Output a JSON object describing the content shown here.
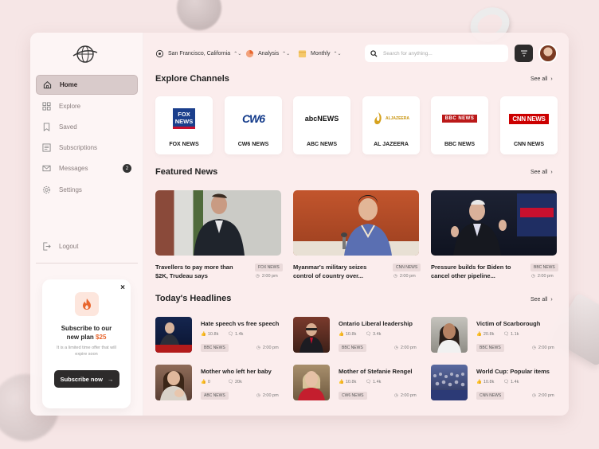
{
  "colors": {
    "accent": "#e8662e",
    "dark": "#2d2b2b",
    "active_nav": "#d9cbcb",
    "panel": "#fbeeee"
  },
  "sidebar": {
    "items": [
      {
        "label": "Home",
        "icon": "home-icon"
      },
      {
        "label": "Explore",
        "icon": "grid-icon"
      },
      {
        "label": "Saved",
        "icon": "bookmark-icon"
      },
      {
        "label": "Subscriptions",
        "icon": "list-icon"
      },
      {
        "label": "Messages",
        "icon": "mail-icon",
        "badge": "2"
      },
      {
        "label": "Settings",
        "icon": "gear-icon"
      }
    ],
    "logout": "Logout"
  },
  "promo": {
    "close": "×",
    "title_pre": "Subscribe to our",
    "title_new": "new plan",
    "price": "$25",
    "note": "It is a limited time offer that will expire soon",
    "button": "Subscribe now"
  },
  "topbar": {
    "location": "San Francisco, California",
    "analysis": "Analysis",
    "period": "Monthly",
    "search_placeholder": "Search for anything..."
  },
  "channels": {
    "title": "Explore Channels",
    "see_all": "See all",
    "items": [
      {
        "name": "FOX NEWS",
        "logo": "FOX NEWS"
      },
      {
        "name": "CW6 NEWS",
        "logo": "CW6"
      },
      {
        "name": "ABC NEWS",
        "logo": "abcNEWS"
      },
      {
        "name": "AL JAZEERA",
        "logo": "ALJAZEERA"
      },
      {
        "name": "BBC NEWS",
        "logo": "BBC NEWS"
      },
      {
        "name": "CNN NEWS",
        "logo": "CNN NEWS"
      }
    ]
  },
  "featured": {
    "title": "Featured News",
    "see_all": "See all",
    "items": [
      {
        "title": "Travellers to pay more than $2K, Trudeau says",
        "tag": "FOX NEWS",
        "time": "2:00 pm"
      },
      {
        "title": "Myanmar's military seizes control of country over...",
        "tag": "CNN NEWS",
        "time": "2:00 pm"
      },
      {
        "title": "Pressure builds for Biden to cancel other pipeline...",
        "tag": "BBC NEWS",
        "time": "2:00 pm"
      }
    ]
  },
  "headlines": {
    "title": "Today's Headlines",
    "see_all": "See all",
    "items": [
      {
        "title": "Hate speech vs free speech",
        "likes": "10.8k",
        "comments": "1.4k",
        "tag": "BBC NEWS",
        "time": "2:00 pm"
      },
      {
        "title": "Ontario Liberal leadership",
        "likes": "10.8k",
        "comments": "3.4k",
        "tag": "BBC NEWS",
        "time": "2:00 pm"
      },
      {
        "title": "Victim of Scarborough",
        "likes": "20.8k",
        "comments": "1.1k",
        "tag": "BBC NEWS",
        "time": "2:00 pm"
      },
      {
        "title": "Mother who left her baby",
        "likes": "0",
        "comments": "20k",
        "tag": "ABC NEWS",
        "time": "2:00 pm"
      },
      {
        "title": "Mother of Stefanie Rengel",
        "likes": "10.8k",
        "comments": "1.4k",
        "tag": "CW6 NEWS",
        "time": "2:00 pm"
      },
      {
        "title": "World Cup: Popular items",
        "likes": "10.8k",
        "comments": "1.4k",
        "tag": "CNN NEWS",
        "time": "2:00 pm"
      }
    ]
  }
}
